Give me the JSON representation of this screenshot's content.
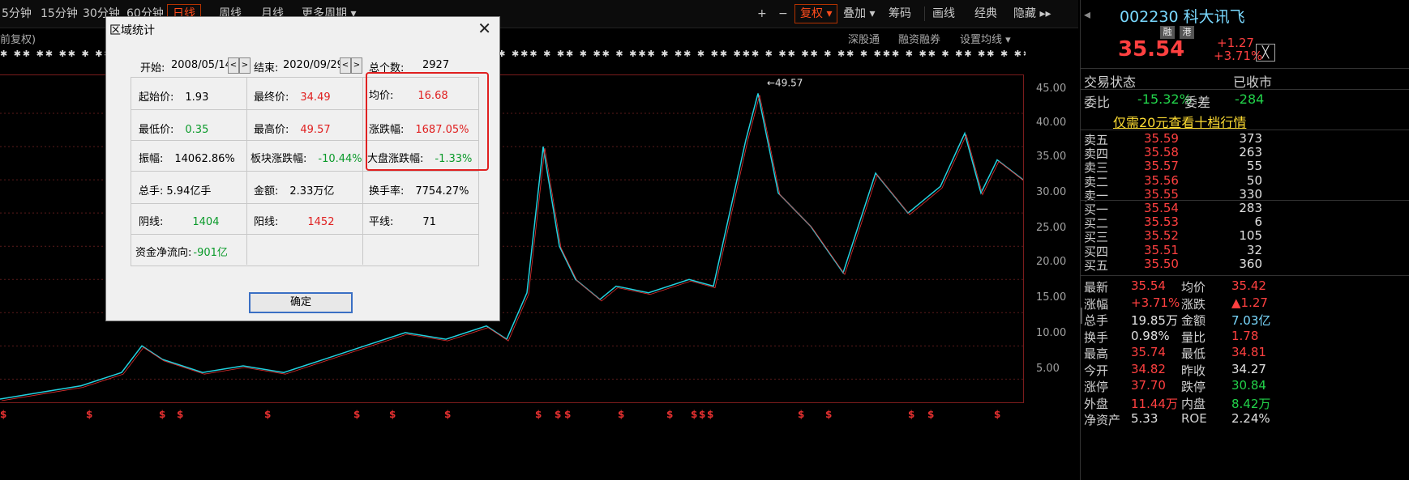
{
  "toolbar": {
    "periods": [
      "5分钟",
      "15分钟",
      "30分钟",
      "60分钟",
      "日线",
      "周线",
      "月线",
      "更多周期 ▾"
    ],
    "tools": [
      "+",
      "−",
      "复权 ▾",
      "叠加 ▾",
      "筹码",
      "画线",
      "经典",
      "隐藏 ▸▸"
    ]
  },
  "subbar": {
    "left": "前复权)",
    "links": [
      "深股通",
      "融资融券",
      "设置均线 ▾"
    ]
  },
  "chart": {
    "peak_label": "49.57",
    "y_ticks": [
      "45.00",
      "40.00",
      "35.00",
      "30.00",
      "25.00",
      "20.00",
      "15.00",
      "10.00",
      "5.00"
    ]
  },
  "chart_data": {
    "type": "line",
    "title": "",
    "y_ticks": [
      45,
      40,
      35,
      30,
      25,
      20,
      15,
      10,
      5
    ],
    "ylim": [
      2,
      50
    ],
    "x": [
      0,
      50,
      100,
      150,
      175,
      200,
      250,
      300,
      350,
      400,
      450,
      500,
      550,
      600,
      625,
      650,
      670,
      690,
      710,
      740,
      760,
      800,
      850,
      880,
      900,
      920,
      935,
      960,
      1000,
      1040,
      1080,
      1120,
      1160,
      1190,
      1210,
      1230,
      1262
    ],
    "values": [
      2,
      3,
      4,
      6,
      10,
      8,
      6,
      7,
      6,
      8,
      10,
      12,
      11,
      13,
      11,
      18,
      40,
      25,
      20,
      17,
      19,
      18,
      20,
      19,
      30,
      41,
      48,
      33,
      28,
      21,
      36,
      30,
      34,
      42,
      33,
      38,
      35
    ],
    "peak": 49.57
  },
  "dialog": {
    "title": "区域统计",
    "close": "✕",
    "start_label": "开始:",
    "start_value": "2008/05/14",
    "end_label": "结束:",
    "end_value": "2020/09/29",
    "spin_left": "<",
    "spin_right": ">",
    "total_label": "总个数:",
    "total_value": "2927",
    "rows": [
      [
        {
          "l": "起始价:",
          "v": "1.93"
        },
        {
          "l": "最终价:",
          "v": "34.49"
        },
        {
          "l": "均价:",
          "v": "16.68"
        }
      ],
      [
        {
          "l": "最低价:",
          "v": "0.35"
        },
        {
          "l": "最高价:",
          "v": "49.57"
        },
        {
          "l": "涨跌幅:",
          "v": "1687.05%"
        }
      ],
      [
        {
          "l": "振幅:",
          "v": "14062.86%"
        },
        {
          "l": "板块涨跌幅:",
          "v": "-10.44%"
        },
        {
          "l": "大盘涨跌幅:",
          "v": "-1.33%"
        }
      ],
      [
        {
          "l": "总手:",
          "v": "5.94亿手"
        },
        {
          "l": "金额:",
          "v": "2.33万亿"
        },
        {
          "l": "换手率:",
          "v": "7754.27%"
        }
      ],
      [
        {
          "l": "阴线:",
          "v": "1404"
        },
        {
          "l": "阳线:",
          "v": "1452"
        },
        {
          "l": "平线:",
          "v": "71"
        }
      ],
      [
        {
          "l": "资金净流向:",
          "v": "-901亿"
        }
      ]
    ],
    "ok": "确定"
  },
  "quote": {
    "code_name": "002230 科大讯飞",
    "badges": [
      "融",
      "港"
    ],
    "price": "35.54",
    "change": "+1.27",
    "change_pct": "+3.71%",
    "close_btn": "╳",
    "status_label": "交易状态",
    "status_value": "已收市",
    "weibi_label": "委比",
    "weibi_value": "-15.32%",
    "weicha_label": "委差",
    "weicha_value": "-284",
    "promo": "仅需20元查看十档行情",
    "sells": [
      {
        "label": "卖五",
        "price": "35.59",
        "vol": "373"
      },
      {
        "label": "卖四",
        "price": "35.58",
        "vol": "263"
      },
      {
        "label": "卖三",
        "price": "35.57",
        "vol": "55"
      },
      {
        "label": "卖二",
        "price": "35.56",
        "vol": "50"
      },
      {
        "label": "卖一",
        "price": "35.55",
        "vol": "330"
      }
    ],
    "buys": [
      {
        "label": "买一",
        "price": "35.54",
        "vol": "283"
      },
      {
        "label": "买二",
        "price": "35.53",
        "vol": "6"
      },
      {
        "label": "买三",
        "price": "35.52",
        "vol": "105"
      },
      {
        "label": "买四",
        "price": "35.51",
        "vol": "32"
      },
      {
        "label": "买五",
        "price": "35.50",
        "vol": "360"
      }
    ],
    "stats": [
      [
        "最新",
        "35.54",
        "均价",
        "35.42"
      ],
      [
        "涨幅",
        "+3.71%",
        "涨跌",
        "▲1.27"
      ],
      [
        "总手",
        "19.85万",
        "金额",
        "7.03亿"
      ],
      [
        "换手",
        "0.98%",
        "量比",
        "1.78"
      ],
      [
        "最高",
        "35.74",
        "最低",
        "34.81"
      ],
      [
        "今开",
        "34.82",
        "昨收",
        "34.27"
      ],
      [
        "涨停",
        "37.70",
        "跌停",
        "30.84"
      ],
      [
        "外盘",
        "11.44万",
        "内盘",
        "8.42万"
      ],
      [
        "净资产",
        "5.33",
        "ROE",
        "2.24%"
      ]
    ]
  },
  "colors": {
    "up": "#ff4040",
    "down": "#22d24a",
    "cyan": "#7ad9ff",
    "bg": "#000000"
  }
}
